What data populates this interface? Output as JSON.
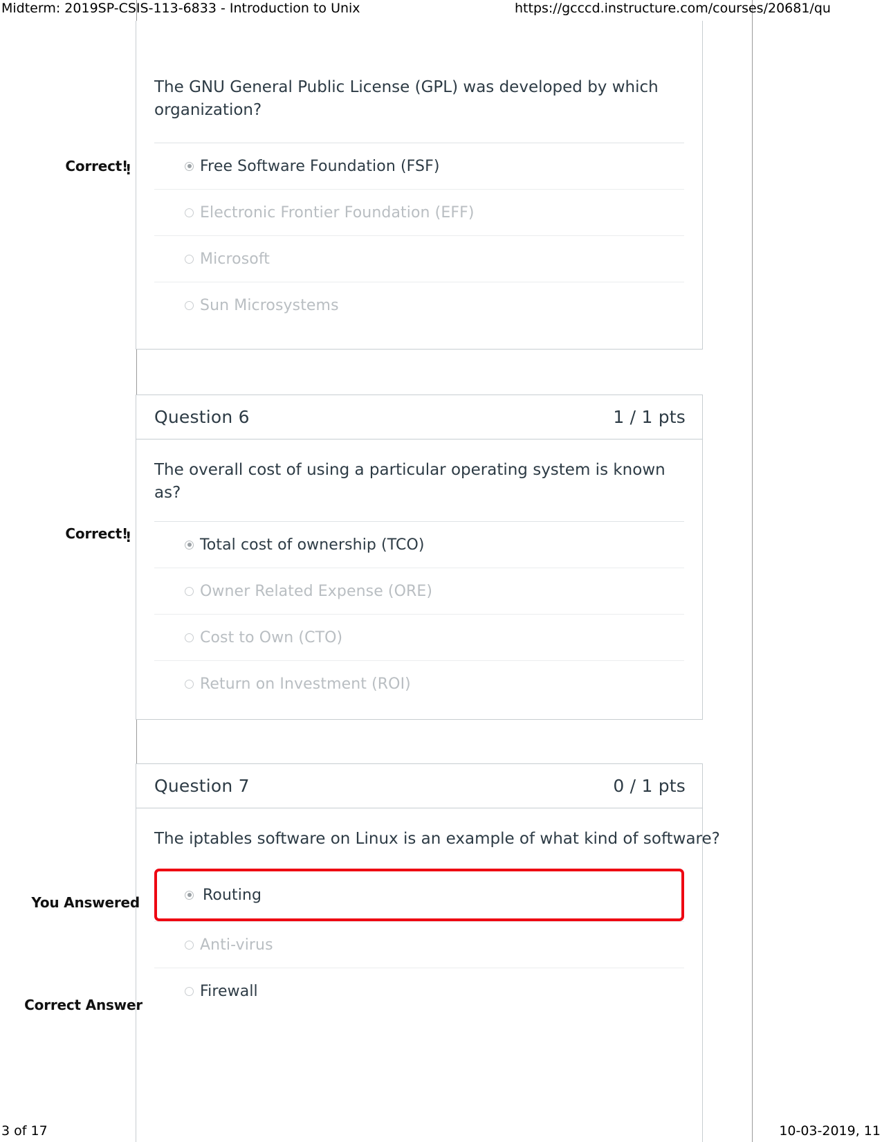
{
  "print_header": {
    "title": "Midterm: 2019SP-CSIS-113-6833 - Introduction to Unix",
    "url": "https://gcccd.instructure.com/courses/20681/qu"
  },
  "print_footer": {
    "page": "3 of 17",
    "date": "10-03-2019, 11"
  },
  "questions": [
    {
      "name": "",
      "points": "",
      "status_label": "Correct!",
      "prompt": "The GNU General Public License (GPL) was developed by which organization?",
      "answers": [
        {
          "label": "Free Software Foundation (FSF)",
          "state": "selected-correct"
        },
        {
          "label": "Electronic Frontier Foundation (EFF)",
          "state": "normal"
        },
        {
          "label": "Microsoft",
          "state": "normal"
        },
        {
          "label": "Sun Microsystems",
          "state": "normal"
        }
      ]
    },
    {
      "name": "Question 6",
      "points": "1 / 1 pts",
      "status_label": "Correct!",
      "prompt": "The overall cost of using a particular operating system is known as?",
      "answers": [
        {
          "label": "Total cost of ownership (TCO)",
          "state": "selected-correct"
        },
        {
          "label": "Owner Related Expense (ORE)",
          "state": "normal"
        },
        {
          "label": "Cost to Own (CTO)",
          "state": "normal"
        },
        {
          "label": "Return on Investment (ROI)",
          "state": "normal"
        }
      ]
    },
    {
      "name": "Question 7",
      "points": "0 / 1 pts",
      "status_label_answered": "You Answered",
      "status_label_correct": "Correct Answer",
      "prompt": "The iptables software on Linux is an example of what kind of software?",
      "answers": [
        {
          "label": "Routing",
          "state": "wrong-selected"
        },
        {
          "label": "Anti-virus",
          "state": "normal"
        },
        {
          "label": "Firewall",
          "state": "correct-answer"
        }
      ]
    }
  ],
  "colors": {
    "wrong_highlight": "#ee0612",
    "text": "#2d3b45",
    "muted_text": "#b9bec2",
    "border": "#c7cdd1"
  }
}
